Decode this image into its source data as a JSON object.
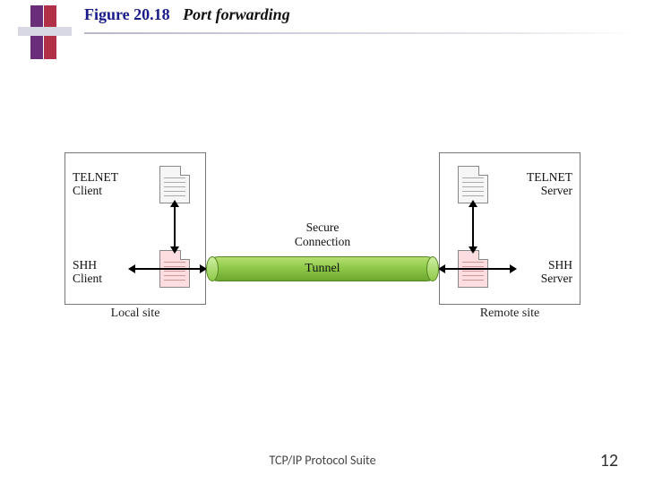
{
  "header": {
    "figure_label": "Figure 20.18",
    "caption": "Port forwarding"
  },
  "diagram": {
    "sites": {
      "left": {
        "caption": "Local site",
        "telnet": "TELNET\nClient",
        "shh": "SHH\nClient"
      },
      "right": {
        "caption": "Remote site",
        "telnet": "TELNET\nServer",
        "shh": "SHH\nServer"
      }
    },
    "tunnel": {
      "title": "Secure\nConnection",
      "label": "Tunnel"
    }
  },
  "footer": {
    "text": "TCP/IP Protocol Suite",
    "page": "12"
  }
}
